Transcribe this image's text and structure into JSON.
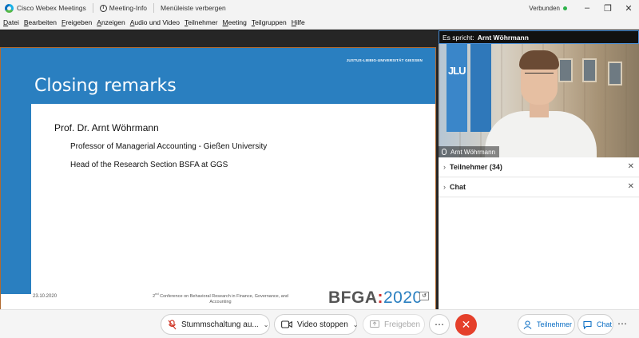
{
  "titlebar": {
    "app_name": "Cisco Webex Meetings",
    "meeting_info": "Meeting-Info",
    "hide_menu": "Menüleiste verbergen",
    "connection_status": "Verbunden"
  },
  "menu": [
    "Datei",
    "Bearbeiten",
    "Freigeben",
    "Anzeigen",
    "Audio und Video",
    "Teilnehmer",
    "Meeting",
    "Teilgruppen",
    "Hilfe"
  ],
  "slide": {
    "university": "JUSTUS-LIEBIG-UNIVERSITÄT GIESSEN",
    "title": "Closing remarks",
    "speaker": "Prof. Dr. Arnt Wöhrmann",
    "line1": "Professor of Managerial Accounting - Gießen University",
    "line2": "Head of the Research Section BSFA at GGS",
    "date": "23.10.2020",
    "conference_ord": "2",
    "conference_sup": "nd",
    "conference_rest": " Conference on Behavioral Research in Finance, Governance, and Accounting",
    "logo_text": "BFGA",
    "logo_year": "2020"
  },
  "panel": {
    "speaking_label": "Es spricht:",
    "speaking_name": "Arnt Wöhrmann",
    "video_name": "Arnt Wöhrmann",
    "video_flag_text": "JLU",
    "participants": "Teilnehmer (34)",
    "chat": "Chat"
  },
  "controls": {
    "mute": "Stummschaltung au...",
    "video": "Video stoppen",
    "share": "Freigeben",
    "participants": "Teilnehmer",
    "chat": "Chat"
  },
  "colors": {
    "slide_blue": "#2a7fc0",
    "end_red": "#e5402b",
    "status_green": "#2db24a",
    "link_blue": "#0b6ec4"
  }
}
